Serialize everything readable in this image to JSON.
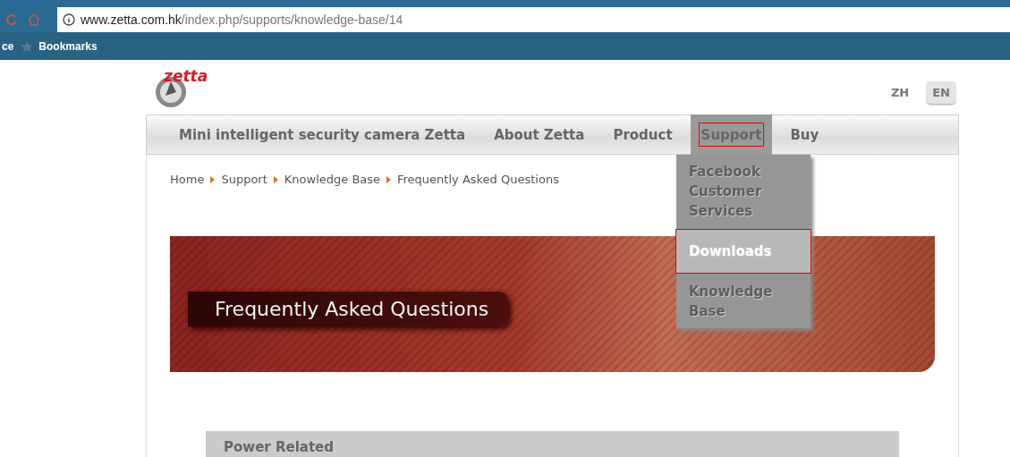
{
  "browser": {
    "url_host": "www.zetta.com.hk",
    "url_path": "/index.php/supports/knowledge-base/14",
    "bookmarks_bar": [
      {
        "label": "ce",
        "kind": "text"
      },
      {
        "label": "Bookmarks",
        "kind": "star"
      }
    ]
  },
  "logo_text": "zetta",
  "languages": [
    {
      "label": "ZH",
      "selected": false
    },
    {
      "label": "EN",
      "selected": true
    }
  ],
  "nav": [
    {
      "label": "Mini intelligent security camera Zetta",
      "selected": false
    },
    {
      "label": "About Zetta",
      "selected": false
    },
    {
      "label": "Product",
      "selected": false
    },
    {
      "label": "Support",
      "selected": true
    },
    {
      "label": "Buy",
      "selected": false
    }
  ],
  "dropdown": [
    {
      "label": "Facebook Customer Services",
      "selected": false
    },
    {
      "label": "Downloads",
      "selected": true
    },
    {
      "label": "Knowledge Base",
      "selected": false
    }
  ],
  "breadcrumb": [
    "Home",
    "Support",
    "Knowledge Base",
    "Frequently Asked Questions"
  ],
  "banner_title": "Frequently Asked Questions",
  "sections": [
    {
      "title": "Power Related"
    }
  ]
}
